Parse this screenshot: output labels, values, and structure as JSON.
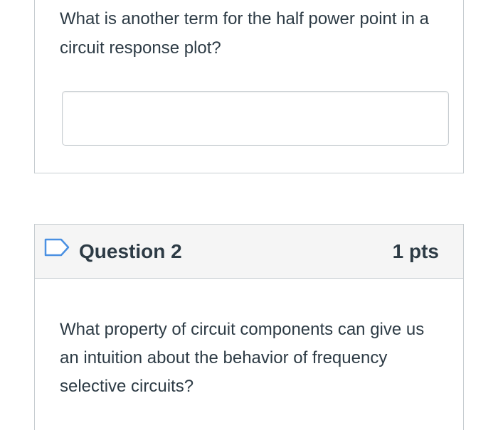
{
  "question_1": {
    "text": "What is another term for the half power point in a circuit response plot?",
    "answer_value": "",
    "answer_placeholder": ""
  },
  "question_2": {
    "flag_icon": "flag-outline-icon",
    "title": "Question 2",
    "points": "1 pts",
    "text": "What property of circuit components can give us an intuition about the behavior of frequency selective circuits?"
  },
  "colors": {
    "text": "#2d3b45",
    "border": "#c7cdd1",
    "header_background": "#f5f5f5",
    "flag_icon": "#4a90e2"
  }
}
